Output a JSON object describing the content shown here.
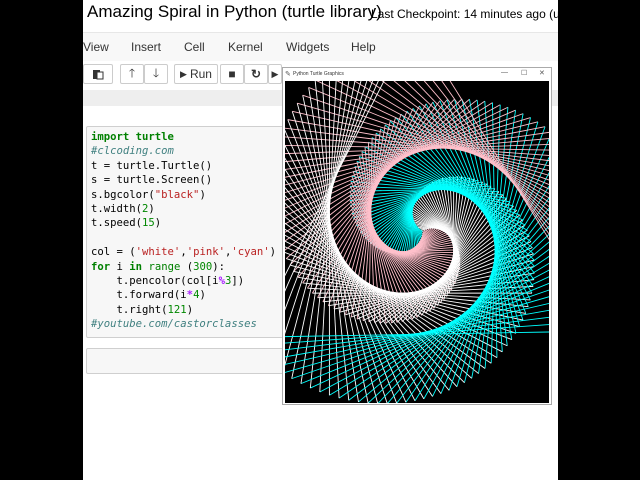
{
  "notebook": {
    "title": "Amazing Spiral in Python (turtle library)",
    "checkpoint": "Last Checkpoint: 14 minutes ago",
    "status": "(un"
  },
  "menu": [
    "View",
    "Insert",
    "Cell",
    "Kernel",
    "Widgets",
    "Help"
  ],
  "toolbar": {
    "run_label": "Run"
  },
  "code_lines": [
    "import turtle",
    "#clcoding.com",
    "t = turtle.Turtle()",
    "s = turtle.Screen()",
    "s.bgcolor(\"black\")",
    "t.width(2)",
    "t.speed(15)",
    "",
    "col = ('white','pink','cyan')",
    "for i in range (300):",
    "    t.pencolor(col[i%3])",
    "    t.forward(i*4)",
    "    t.right(121)",
    "#youtube.com/castorclasses"
  ],
  "turtle_window": {
    "title": "Python Turtle Graphics",
    "colors": [
      "#ffffff",
      "#ffc0cb",
      "#00ffff"
    ],
    "background": "#000000"
  }
}
